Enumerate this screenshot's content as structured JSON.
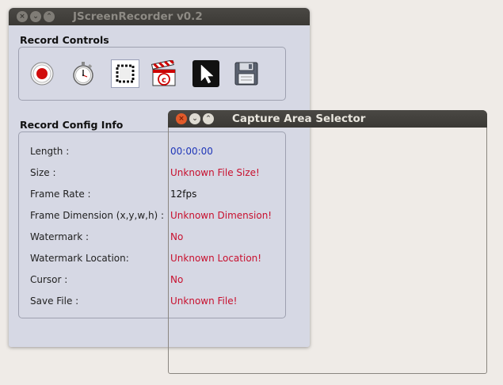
{
  "main_window": {
    "title": "JScreenRecorder v0.2",
    "controls": {
      "close": "×",
      "minimize": "⌄",
      "maximize": "⌃"
    },
    "record_controls_label": "Record Controls",
    "tools": [
      {
        "name": "record-icon"
      },
      {
        "name": "stopwatch-icon"
      },
      {
        "name": "capture-area-icon"
      },
      {
        "name": "watermark-clapper-icon"
      },
      {
        "name": "cursor-icon"
      },
      {
        "name": "save-floppy-icon"
      }
    ],
    "config_label": "Record Config Info",
    "config_rows": [
      {
        "label": "Length :",
        "value": "00:00:00",
        "color": "#1f36b8"
      },
      {
        "label": "Size :",
        "value": "Unknown File Size!",
        "color": "#c8102e"
      },
      {
        "label": "Frame Rate :",
        "value": "12fps",
        "color": "#111111"
      },
      {
        "label": "Frame Dimension (x,y,w,h) :",
        "value": "Unknown Dimension!",
        "color": "#c8102e"
      },
      {
        "label": "Watermark :",
        "value": "No",
        "color": "#c8102e"
      },
      {
        "label": "Watermark Location:",
        "value": "Unknown Location!",
        "color": "#c8102e"
      },
      {
        "label": "Cursor :",
        "value": "No",
        "color": "#c8102e"
      },
      {
        "label": "Save File :",
        "value": "Unknown File!",
        "color": "#c8102e"
      }
    ]
  },
  "capture_window": {
    "title": "Capture Area Selector",
    "controls": {
      "close": "×",
      "minimize": "⌄",
      "maximize": "⌃"
    }
  },
  "colors": {
    "titlebar": "#3c3b37",
    "panel": "#d6d8e4",
    "desktop": "#efebe7",
    "accent_red": "#c8102e",
    "accent_blue": "#1f36b8"
  }
}
